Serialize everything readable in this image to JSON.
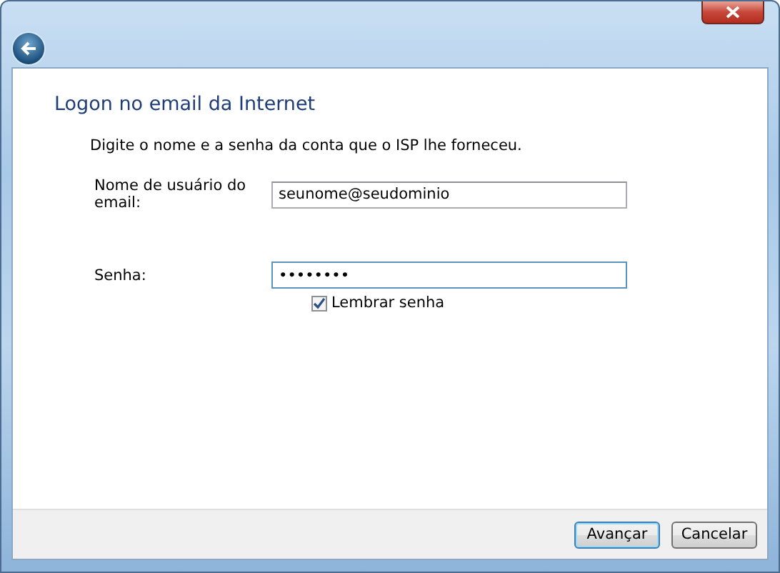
{
  "window": {
    "title": "Logon no email da Internet"
  },
  "instruction": "Digite o nome e a senha da conta que o ISP lhe forneceu.",
  "fields": [
    {
      "label": "Nome de usuário do email:",
      "value": "seunome@seudominio",
      "focused": false
    },
    {
      "label": "Senha:",
      "value": "••••••••",
      "focused": true
    }
  ],
  "remember": {
    "label": "Lembrar senha",
    "checked": true
  },
  "buttons": [
    {
      "label": "Avançar",
      "default": true
    },
    {
      "label": "Cancelar",
      "default": false
    }
  ]
}
